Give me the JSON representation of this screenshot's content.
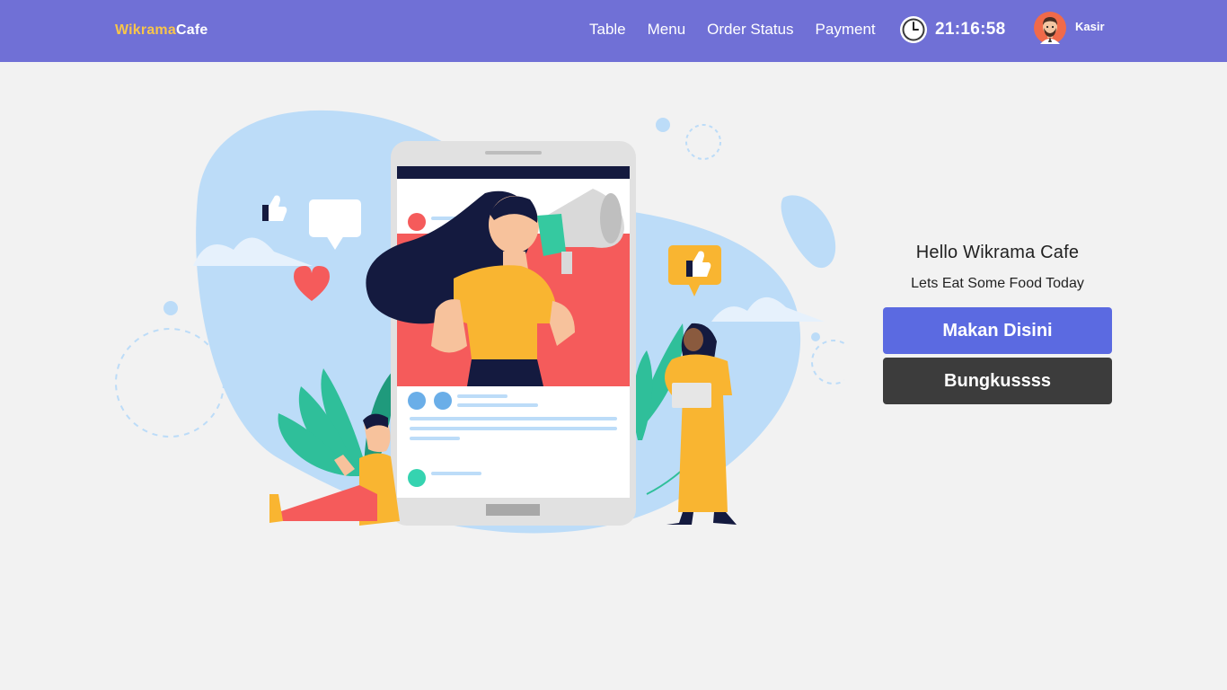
{
  "brand": {
    "part1": "Wikrama",
    "part2": "Cafe"
  },
  "nav": {
    "items": [
      {
        "label": "Table"
      },
      {
        "label": "Menu"
      },
      {
        "label": "Order Status"
      },
      {
        "label": "Payment"
      }
    ]
  },
  "clock": {
    "time": "21:16:58",
    "icon": "clock-icon"
  },
  "user": {
    "name": "Kasir",
    "icon": "avatar"
  },
  "panel": {
    "greeting": "Hello Wikrama Cafe",
    "subtitle": "Lets Eat Some Food Today",
    "dine_in_label": "Makan Disini",
    "takeaway_label": "Bungkussss"
  },
  "colors": {
    "navbar": "#7070d6",
    "brand_accent": "#f8c54a",
    "dine_in_button": "#5b6ae1",
    "takeaway_button": "#3c3c3c",
    "background": "#f2f2f2"
  },
  "illustration": {
    "icon": "social-media-promotion-illustration"
  }
}
